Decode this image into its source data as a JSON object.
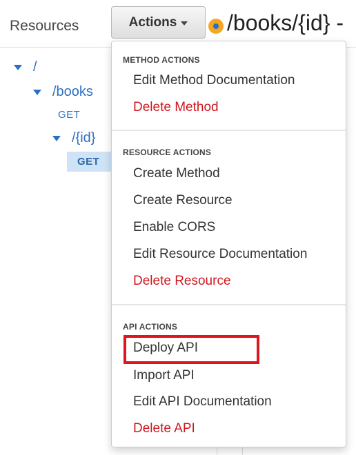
{
  "sidebar": {
    "header": "Resources",
    "tree": [
      {
        "path": "/"
      },
      {
        "path": "/books",
        "method": "GET"
      },
      {
        "path": "/{id}",
        "method": "GET"
      }
    ]
  },
  "toolbar": {
    "actions_label": "Actions"
  },
  "page": {
    "title": "/books/{id} -"
  },
  "dropdown": {
    "method_actions": {
      "header": "METHOD ACTIONS",
      "items": [
        "Edit Method Documentation",
        "Delete Method"
      ]
    },
    "resource_actions": {
      "header": "RESOURCE ACTIONS",
      "items": [
        "Create Method",
        "Create Resource",
        "Enable CORS",
        "Edit Resource Documentation",
        "Delete Resource"
      ]
    },
    "api_actions": {
      "header": "API ACTIONS",
      "items": [
        "Deploy API",
        "Import API",
        "Edit API Documentation",
        "Delete API"
      ]
    }
  },
  "colors": {
    "link": "#2b71c3",
    "danger": "#d0161e",
    "highlight": "#e0141e",
    "selected_bg": "#cfe3f7"
  }
}
